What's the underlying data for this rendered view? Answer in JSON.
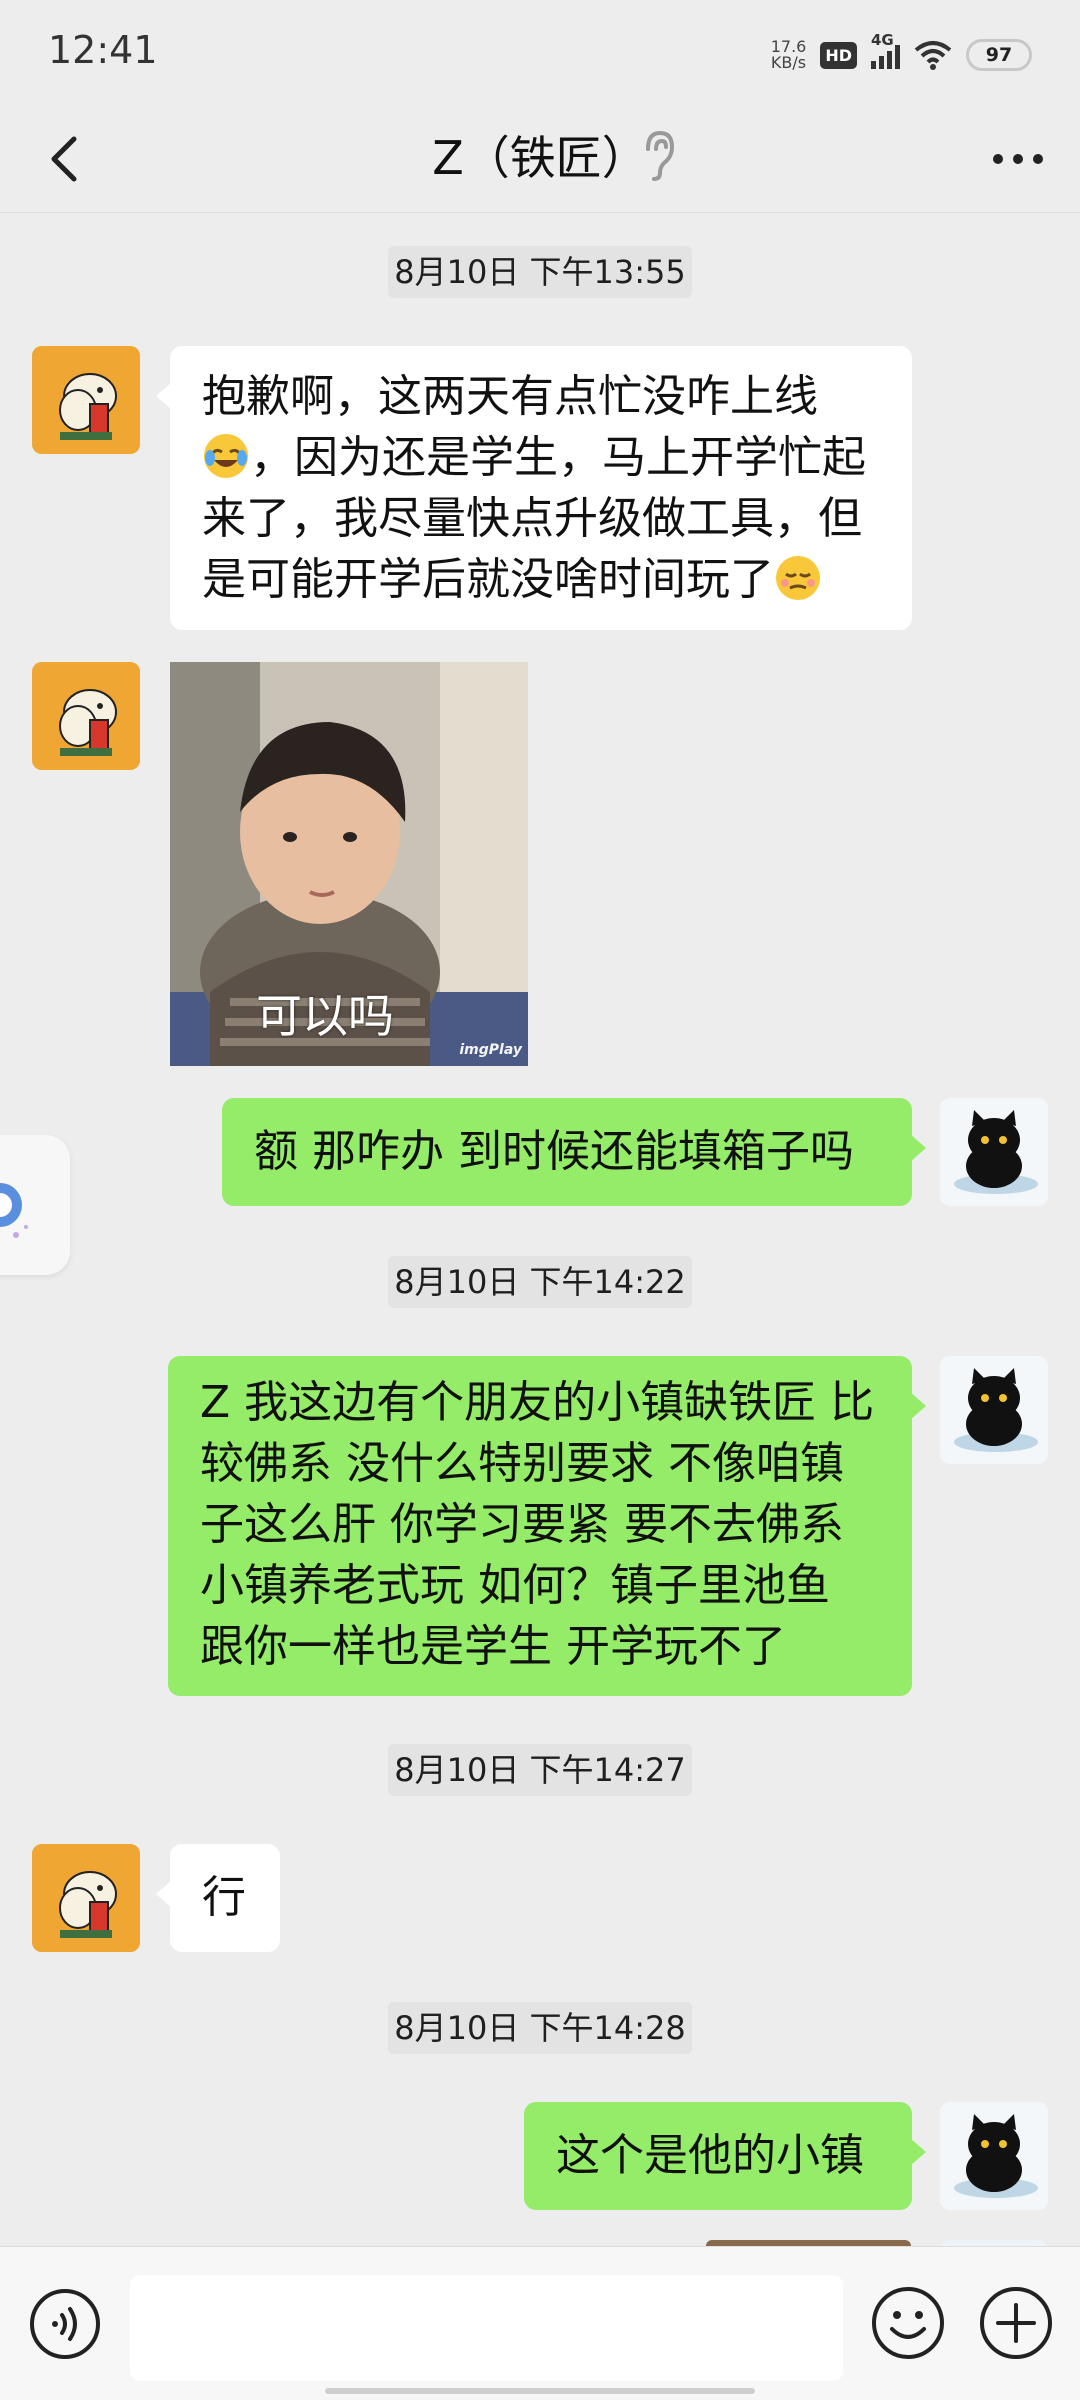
{
  "status_bar": {
    "time": "12:41",
    "net_speed_value": "17.6",
    "net_speed_unit": "KB/s",
    "hd_label": "HD",
    "network_label": "4G",
    "battery": "97"
  },
  "header": {
    "title": "Z（铁匠）",
    "icons": [
      "back-arrow-icon",
      "ear-icon",
      "more-icon"
    ]
  },
  "messages": [
    {
      "type": "time",
      "text": "8月10日 下午13:55"
    },
    {
      "type": "text",
      "from": "contact",
      "lines": [
        "抱歉啊，这两天有点忙没咋上线",
        "，因为还是学生，马上开学忙起",
        "来了，我尽量快点升级做工具，但",
        "是可能开学后就没啥时间玩了"
      ],
      "emojis": [
        "laughing-tears-emoji",
        "worried-emoji"
      ]
    },
    {
      "type": "sticker",
      "from": "contact",
      "caption": "可以吗",
      "watermark": "imgPlay"
    },
    {
      "type": "text",
      "from": "me",
      "lines": [
        "额 那咋办 到时候还能填箱子吗"
      ]
    },
    {
      "type": "time",
      "text": "8月10日 下午14:22"
    },
    {
      "type": "text",
      "from": "me",
      "lines": [
        "Z 我这边有个朋友的小镇缺铁匠 比",
        "较佛系 没什么特别要求 不像咱镇",
        "子这么肝 你学习要紧 要不去佛系",
        "小镇养老式玩 如何？镇子里池鱼",
        "跟你一样也是学生 开学玩不了"
      ]
    },
    {
      "type": "time",
      "text": "8月10日 下午14:27"
    },
    {
      "type": "text",
      "from": "contact",
      "lines": [
        "行"
      ]
    },
    {
      "type": "time",
      "text": "8月10日 下午14:28"
    },
    {
      "type": "text",
      "from": "me",
      "lines": [
        "这个是他的小镇"
      ]
    }
  ],
  "input_bar": {
    "placeholder": "",
    "icons": [
      "voice-icon",
      "emoji-icon",
      "plus-icon"
    ]
  },
  "colors": {
    "background": "#ededed",
    "my_bubble": "#95ec69",
    "contact_bubble": "#ffffff",
    "contact_avatar": "#f0a632"
  }
}
